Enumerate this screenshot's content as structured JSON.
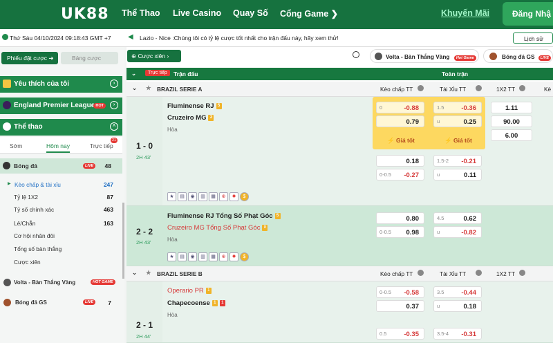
{
  "header": {
    "logo": "UK88",
    "nav": [
      "Thể Thao",
      "Live Casino",
      "Quay Số",
      "Cổng Game"
    ],
    "promo": "Khuyến Mãi",
    "register": "Đăng Nhậ"
  },
  "topbar": {
    "datetime": "Thứ Sáu 04/10/2024 09:18:43 GMT +7",
    "ticker": "Lazio - Nice :Chúng tôi có tỷ lệ cược tốt nhất cho trận đấu này, hãy xem thử!",
    "history": "Lịch sử"
  },
  "sidebar": {
    "tab_active": "Phiếu đặt cược",
    "tab_inactive": "Bảng cược",
    "favorites": "Yêu thích của tôi",
    "epl": "England Premier League",
    "hot": "HOT",
    "sports": "Thể thao",
    "time_tabs": [
      "Sớm",
      "Hôm nay",
      "Trực tiếp"
    ],
    "live_count": "21",
    "football": "Bóng đá",
    "live": "LIVE",
    "football_count": "48",
    "sub_items": [
      {
        "label": "Kèo chấp & tài xỉu",
        "count": "247"
      },
      {
        "label": "Tỷ lệ 1X2",
        "count": "87"
      },
      {
        "label": "Tỷ số chính xác",
        "count": "463"
      },
      {
        "label": "Lẻ/Chẵn",
        "count": "163"
      },
      {
        "label": "Cơ hội nhân đôi",
        "count": ""
      },
      {
        "label": "Tổng số bàn thắng",
        "count": ""
      },
      {
        "label": "Cược xiên",
        "count": ""
      }
    ],
    "volta": "Volta - Bàn Thắng Vàng",
    "hot_game": "HOT GAME",
    "gs": "Bóng đá GS",
    "gs_count": "7"
  },
  "toolbar": {
    "parlay": "Cược xiên",
    "volta": "Volta - Bàn Thắng Vàng",
    "gs": "Bóng đá GS",
    "hot_game": "Hot Game",
    "live": "LIVE"
  },
  "table": {
    "live_tag": "Trực tiếp",
    "match_col": "Trận đấu",
    "full_col": "Toàn trận",
    "hc": "Kèo chấp TT",
    "ou": "Tài Xỉu TT",
    "x12": "1X2 TT",
    "more": "Kè"
  },
  "leagues": [
    "BRAZIL SERIE A",
    "BRAZIL SERIE B"
  ],
  "m1": {
    "home": "Fluminense RJ",
    "away": "Cruzeiro MG",
    "draw": "Hòa",
    "score": "1 - 0",
    "time": "2H 43'",
    "b1": "5",
    "b2": "2",
    "hc1": [
      "0",
      "-0.88"
    ],
    "hc2": [
      "",
      "0.79"
    ],
    "ou1": [
      "1.5",
      "-0.36"
    ],
    "ou2": [
      "u",
      "0.25"
    ],
    "x1": "1.11",
    "x2": "90.00",
    "x3": "6.00",
    "gold": "Giá tốt",
    "hc3": [
      "",
      "0.18"
    ],
    "hc4": [
      "0-0.5",
      "-0.27"
    ],
    "ou3": [
      "1.5-2",
      "-0.21"
    ],
    "ou4": [
      "u",
      "0.11"
    ]
  },
  "m2": {
    "home": "Fluminense RJ Tổng Số Phạt Góc",
    "away": "Cruzeiro MG Tổng Số Phạt Góc",
    "draw": "Hòa",
    "score": "2 - 2",
    "time": "2H 43'",
    "b1": "5",
    "b2": "8",
    "hc1": [
      "",
      "0.80"
    ],
    "hc2": [
      "0-0.5",
      "0.98"
    ],
    "ou1": [
      "4.5",
      "0.62"
    ],
    "ou2": [
      "u",
      "-0.82"
    ]
  },
  "m3": {
    "home": "Operario PR",
    "away": "Chapecoense",
    "draw": "Hòa",
    "score": "2 - 1",
    "time": "2H 44'",
    "b1": "1",
    "b2": "1",
    "b3": "1",
    "hc1": [
      "0-0.5",
      "-0.58"
    ],
    "hc2": [
      "",
      "0.37"
    ],
    "ou1": [
      "3.5",
      "-0.44"
    ],
    "ou2": [
      "u",
      "0.18"
    ],
    "hc3": [
      "0.5",
      "-0.35"
    ],
    "ou3": [
      "3.5-4",
      "-0.31"
    ]
  },
  "colors": {
    "brand": "#16723f",
    "accent": "#fdd860",
    "negative": "#d63b3b"
  }
}
